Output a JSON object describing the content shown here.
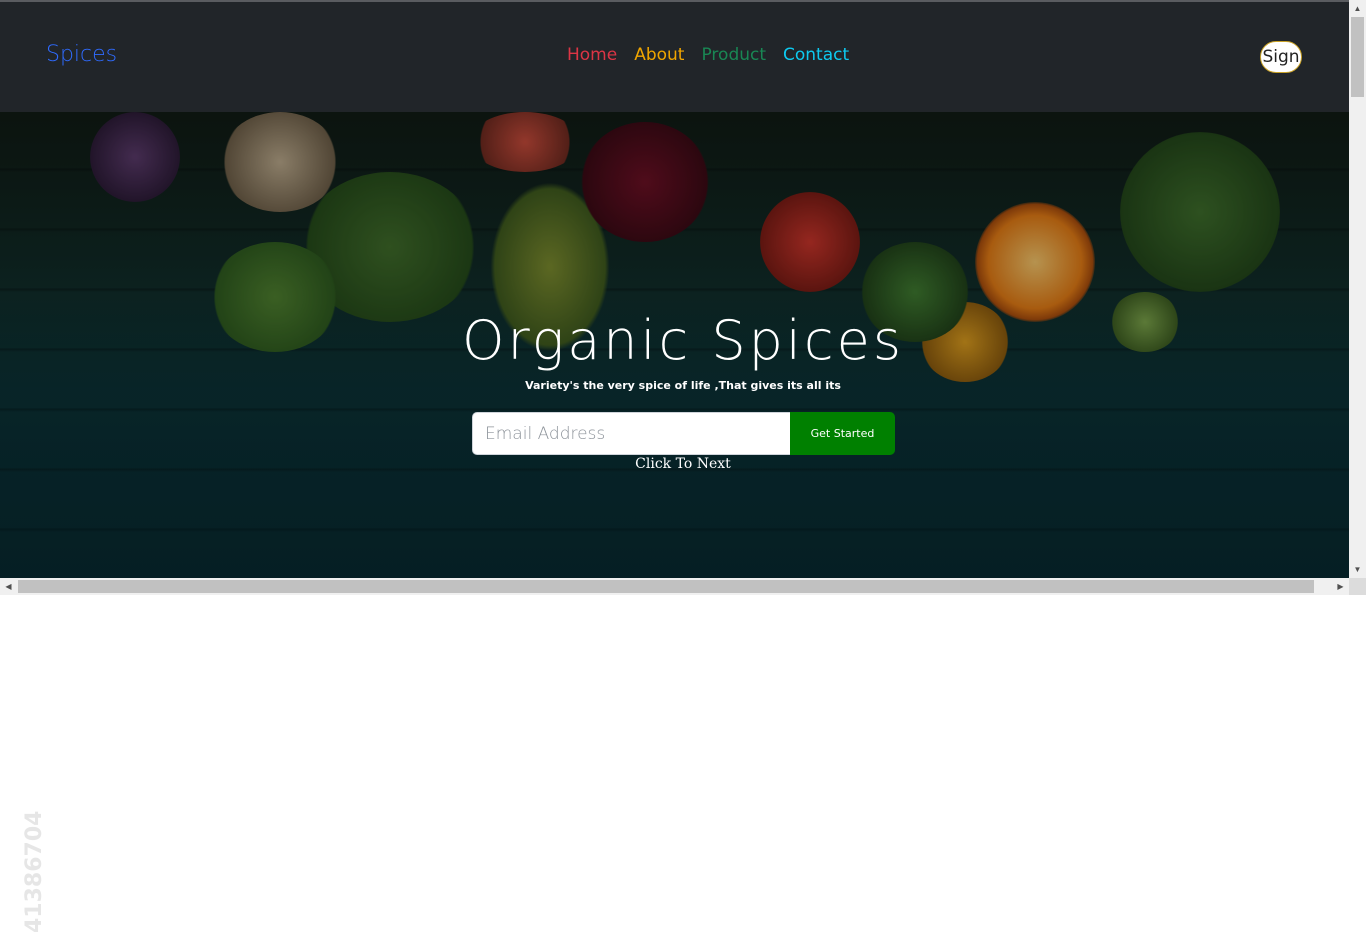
{
  "navbar": {
    "brand": "Spices",
    "links": [
      {
        "label": "Home",
        "color": "#dc3545"
      },
      {
        "label": "About",
        "color": "#f0a500"
      },
      {
        "label": "Product",
        "color": "#198754"
      },
      {
        "label": "Contact",
        "color": "#0dcaf0"
      }
    ],
    "sign_label": "Sign",
    "brand_color": "#2f6bff",
    "background": "#212529"
  },
  "hero": {
    "title": "Organic Spices",
    "subtitle": "Variety's the very spice of life ,That gives its all its",
    "email_placeholder": "Email Address",
    "cta_label": "Get Started",
    "cta_color": "#008000",
    "next_label": "Click To Next",
    "watermark": "41386704"
  },
  "scrollbars": {
    "up_icon": "triangle-up-icon",
    "down_icon": "triangle-down-icon",
    "left_icon": "triangle-left-icon",
    "right_icon": "triangle-right-icon"
  }
}
